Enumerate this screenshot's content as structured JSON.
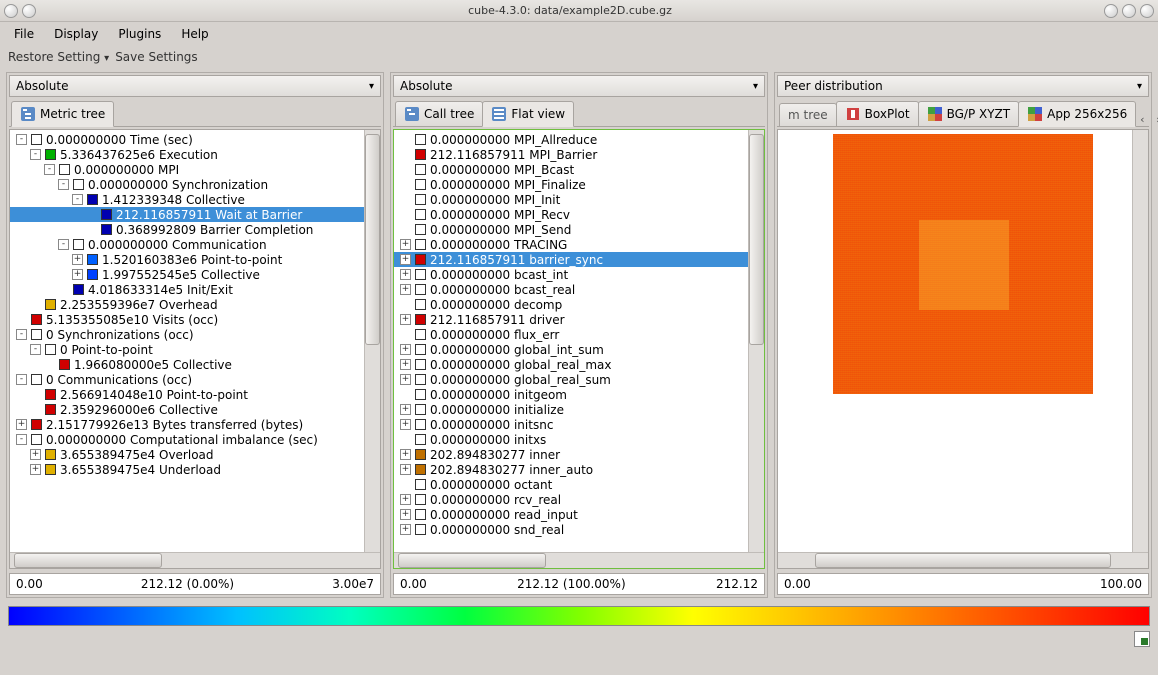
{
  "window": {
    "title": "cube-4.3.0: data/example2D.cube.gz"
  },
  "menu": {
    "file": "File",
    "display": "Display",
    "plugins": "Plugins",
    "help": "Help"
  },
  "settings": {
    "restore": "Restore Setting",
    "save": "Save Settings"
  },
  "left": {
    "dropdown": "Absolute",
    "tab": "Metric tree",
    "scale": {
      "min": "0.00",
      "mid": "212.12 (0.00%)",
      "max": "3.00e7"
    },
    "tree": [
      {
        "d": 0,
        "e": "-",
        "c": "#ffffff",
        "t": "0.000000000 Time (sec)"
      },
      {
        "d": 1,
        "e": "-",
        "c": "#00b000",
        "t": "5.336437625e6 Execution"
      },
      {
        "d": 2,
        "e": "-",
        "c": "#ffffff",
        "t": "0.000000000 MPI"
      },
      {
        "d": 3,
        "e": "-",
        "c": "#ffffff",
        "t": "0.000000000 Synchronization"
      },
      {
        "d": 4,
        "e": "-",
        "c": "#0000b0",
        "t": "1.412339348 Collective"
      },
      {
        "d": 5,
        "e": "",
        "c": "#0000b0",
        "t": "212.116857911 Wait at Barrier",
        "sel": true
      },
      {
        "d": 5,
        "e": "",
        "c": "#0000b0",
        "t": "0.368992809 Barrier Completion"
      },
      {
        "d": 3,
        "e": "-",
        "c": "#ffffff",
        "t": "0.000000000 Communication"
      },
      {
        "d": 4,
        "e": "+",
        "c": "#0060ff",
        "t": "1.520160383e6 Point-to-point"
      },
      {
        "d": 4,
        "e": "+",
        "c": "#0040ff",
        "t": "1.997552545e5 Collective"
      },
      {
        "d": 3,
        "e": "",
        "c": "#0000b0",
        "t": "4.018633314e5 Init/Exit"
      },
      {
        "d": 1,
        "e": "",
        "c": "#e0b000",
        "t": "2.253559396e7 Overhead"
      },
      {
        "d": 0,
        "e": "",
        "c": "#d00000",
        "t": "5.135355085e10 Visits (occ)"
      },
      {
        "d": 0,
        "e": "-",
        "c": "#ffffff",
        "t": "0 Synchronizations (occ)"
      },
      {
        "d": 1,
        "e": "-",
        "c": "#ffffff",
        "t": "0 Point-to-point"
      },
      {
        "d": 2,
        "e": "",
        "c": "#d00000",
        "t": "1.966080000e5 Collective"
      },
      {
        "d": 0,
        "e": "-",
        "c": "#ffffff",
        "t": "0 Communications (occ)"
      },
      {
        "d": 1,
        "e": "",
        "c": "#d00000",
        "t": "2.566914048e10 Point-to-point"
      },
      {
        "d": 1,
        "e": "",
        "c": "#d00000",
        "t": "2.359296000e6 Collective"
      },
      {
        "d": 0,
        "e": "+",
        "c": "#d00000",
        "t": "2.151779926e13 Bytes transferred (bytes)"
      },
      {
        "d": 0,
        "e": "-",
        "c": "#ffffff",
        "t": "0.000000000 Computational imbalance (sec)"
      },
      {
        "d": 1,
        "e": "+",
        "c": "#e0b000",
        "t": "3.655389475e4 Overload"
      },
      {
        "d": 1,
        "e": "+",
        "c": "#e0b000",
        "t": "3.655389475e4 Underload"
      }
    ]
  },
  "mid": {
    "dropdown": "Absolute",
    "tabs": {
      "call": "Call tree",
      "flat": "Flat view"
    },
    "scale": {
      "min": "0.00",
      "mid": "212.12 (100.00%)",
      "max": "212.12"
    },
    "tree": [
      {
        "d": 0,
        "e": "",
        "c": "#ffffff",
        "t": "0.000000000 MPI_Allreduce"
      },
      {
        "d": 0,
        "e": "",
        "c": "#d00000",
        "t": "212.116857911 MPI_Barrier"
      },
      {
        "d": 0,
        "e": "",
        "c": "#ffffff",
        "t": "0.000000000 MPI_Bcast"
      },
      {
        "d": 0,
        "e": "",
        "c": "#ffffff",
        "t": "0.000000000 MPI_Finalize"
      },
      {
        "d": 0,
        "e": "",
        "c": "#ffffff",
        "t": "0.000000000 MPI_Init"
      },
      {
        "d": 0,
        "e": "",
        "c": "#ffffff",
        "t": "0.000000000 MPI_Recv"
      },
      {
        "d": 0,
        "e": "",
        "c": "#ffffff",
        "t": "0.000000000 MPI_Send"
      },
      {
        "d": 0,
        "e": "+",
        "c": "#ffffff",
        "t": "0.000000000 TRACING"
      },
      {
        "d": 0,
        "e": "+",
        "c": "#d00000",
        "t": "212.116857911 barrier_sync",
        "sel": true
      },
      {
        "d": 0,
        "e": "+",
        "c": "#ffffff",
        "t": "0.000000000 bcast_int"
      },
      {
        "d": 0,
        "e": "+",
        "c": "#ffffff",
        "t": "0.000000000 bcast_real"
      },
      {
        "d": 0,
        "e": "",
        "c": "#ffffff",
        "t": "0.000000000 decomp"
      },
      {
        "d": 0,
        "e": "+",
        "c": "#d00000",
        "t": "212.116857911 driver"
      },
      {
        "d": 0,
        "e": "",
        "c": "#ffffff",
        "t": "0.000000000 flux_err"
      },
      {
        "d": 0,
        "e": "+",
        "c": "#ffffff",
        "t": "0.000000000 global_int_sum"
      },
      {
        "d": 0,
        "e": "+",
        "c": "#ffffff",
        "t": "0.000000000 global_real_max"
      },
      {
        "d": 0,
        "e": "+",
        "c": "#ffffff",
        "t": "0.000000000 global_real_sum"
      },
      {
        "d": 0,
        "e": "",
        "c": "#ffffff",
        "t": "0.000000000 initgeom"
      },
      {
        "d": 0,
        "e": "+",
        "c": "#ffffff",
        "t": "0.000000000 initialize"
      },
      {
        "d": 0,
        "e": "+",
        "c": "#ffffff",
        "t": "0.000000000 initsnc"
      },
      {
        "d": 0,
        "e": "",
        "c": "#ffffff",
        "t": "0.000000000 initxs"
      },
      {
        "d": 0,
        "e": "+",
        "c": "#c07000",
        "t": "202.894830277 inner"
      },
      {
        "d": 0,
        "e": "+",
        "c": "#c07000",
        "t": "202.894830277 inner_auto"
      },
      {
        "d": 0,
        "e": "",
        "c": "#ffffff",
        "t": "0.000000000 octant"
      },
      {
        "d": 0,
        "e": "+",
        "c": "#ffffff",
        "t": "0.000000000 rcv_real"
      },
      {
        "d": 0,
        "e": "+",
        "c": "#ffffff",
        "t": "0.000000000 read_input"
      },
      {
        "d": 0,
        "e": "+",
        "c": "#ffffff",
        "t": "0.000000000 snd_real"
      }
    ]
  },
  "right": {
    "dropdown": "Peer distribution",
    "tabs": {
      "mtree": "m tree",
      "box": "BoxPlot",
      "bgp": "BG/P XYZT",
      "app": "App 256x256"
    },
    "scale": {
      "min": "0.00",
      "mid": "",
      "max": "100.00"
    }
  }
}
